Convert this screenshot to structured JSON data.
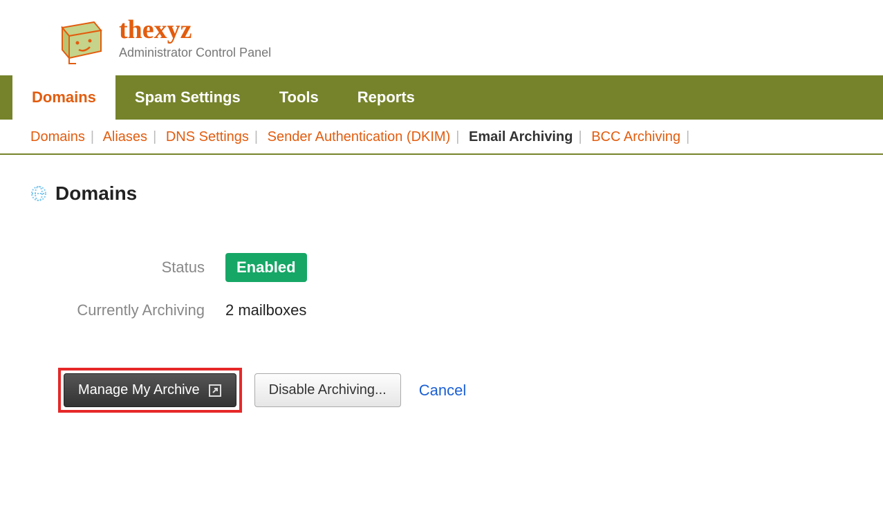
{
  "header": {
    "brand": "thexyz",
    "subtitle": "Administrator Control Panel"
  },
  "nav": {
    "tabs": [
      "Domains",
      "Spam Settings",
      "Tools",
      "Reports"
    ],
    "active_index": 0
  },
  "subnav": {
    "items": [
      "Domains",
      "Aliases",
      "DNS Settings",
      "Sender Authentication (DKIM)",
      "Email Archiving",
      "BCC Archiving"
    ],
    "current_index": 4
  },
  "page": {
    "title": "Domains"
  },
  "status": {
    "label": "Status",
    "badge": "Enabled"
  },
  "archiving": {
    "label": "Currently Archiving",
    "value": "2 mailboxes"
  },
  "actions": {
    "manage": "Manage My Archive",
    "disable": "Disable Archiving...",
    "cancel": "Cancel"
  }
}
